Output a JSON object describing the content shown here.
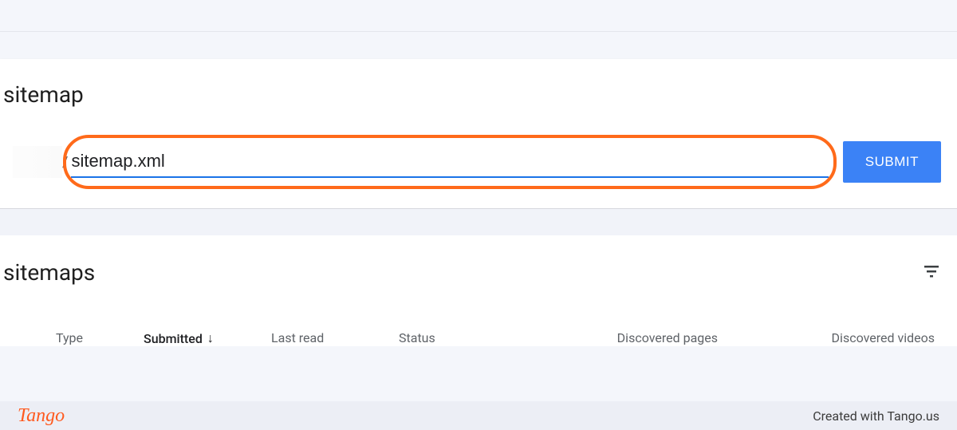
{
  "section1": {
    "title": "sitemap",
    "prefix_separator": "/",
    "input_value": "sitemap.xml",
    "submit_label": "SUBMIT"
  },
  "section2": {
    "title": "sitemaps",
    "columns": {
      "type": "Type",
      "submitted": "Submitted",
      "last_read": "Last read",
      "status": "Status",
      "discovered_pages": "Discovered pages",
      "discovered_videos": "Discovered videos"
    },
    "sort_arrow": "↓"
  },
  "footer": {
    "brand": "Tango",
    "credit": "Created with Tango.us"
  }
}
